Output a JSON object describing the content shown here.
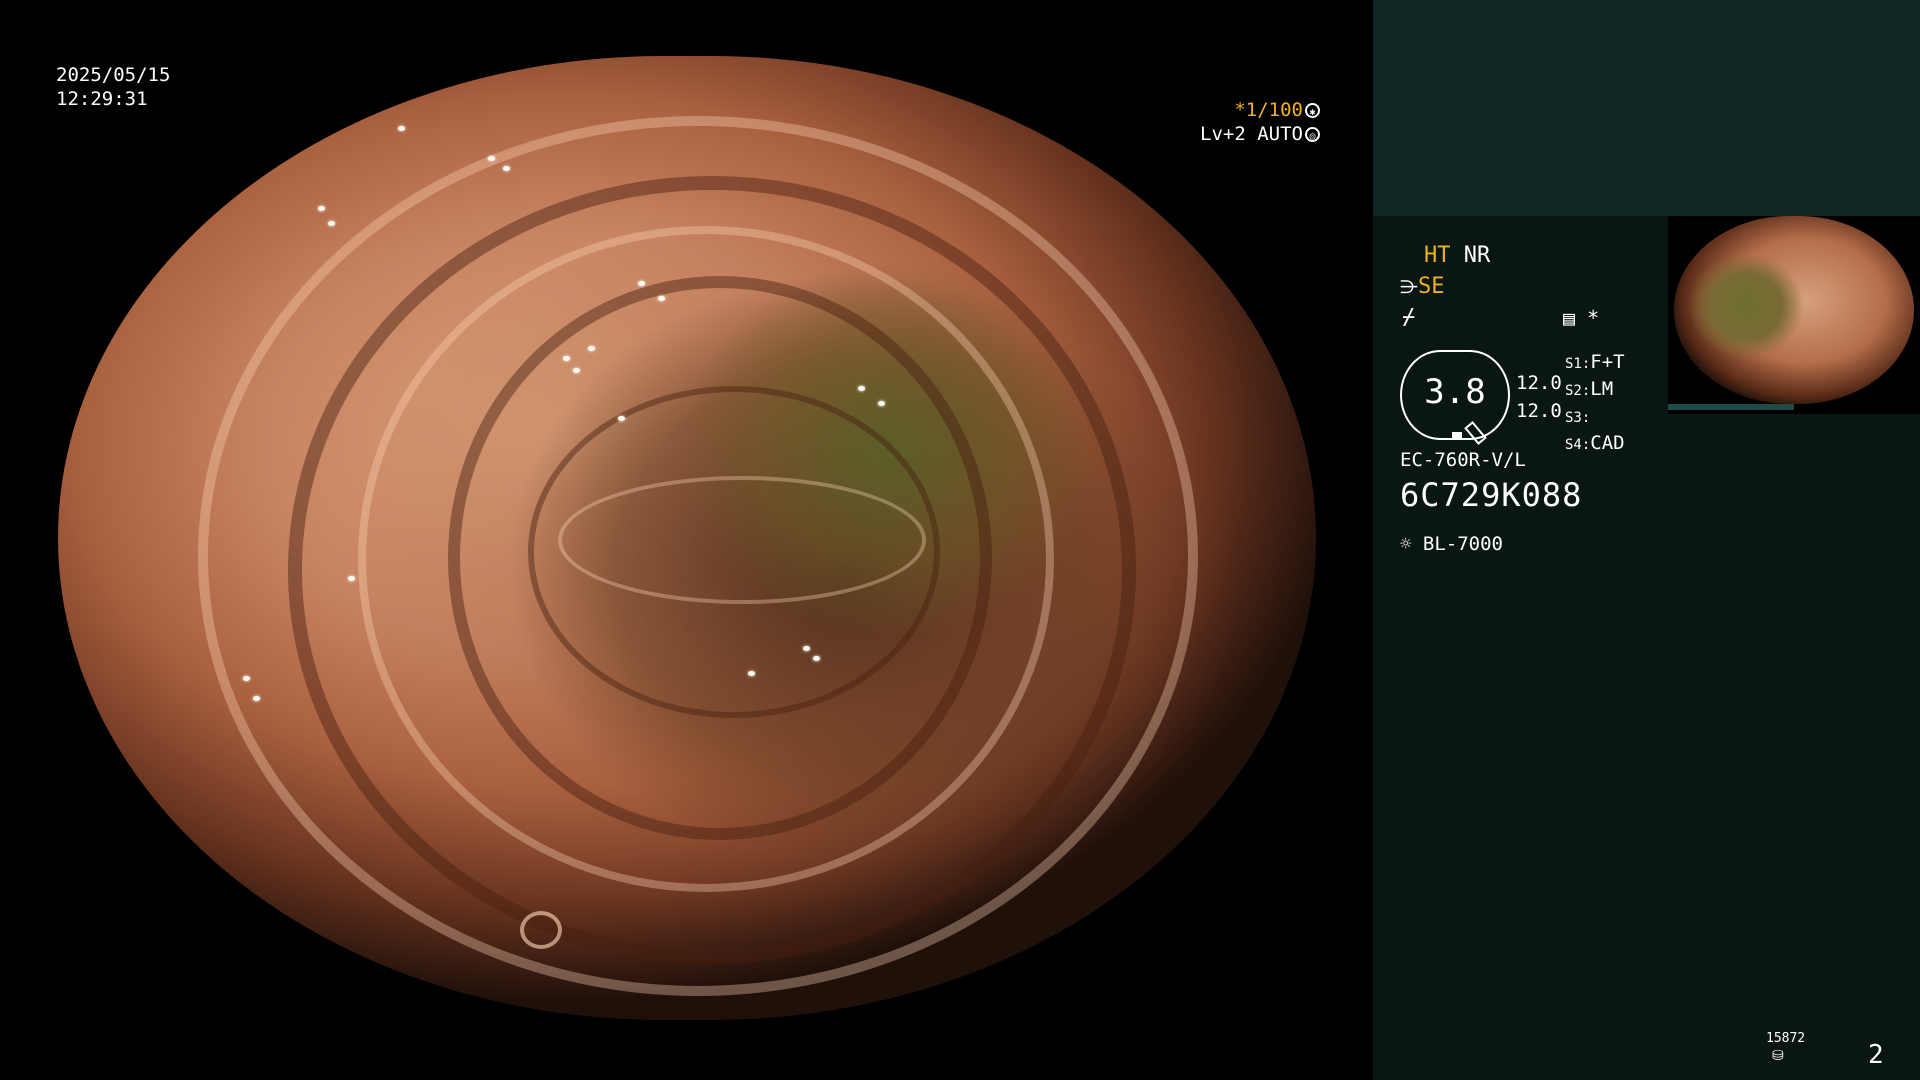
{
  "timestamp": {
    "date": "2025/05/15",
    "time": "12:29:31"
  },
  "shutter": {
    "value": "*1/100",
    "level": "Lv+2",
    "mode": "AUTO",
    "value_color": "#f0b020"
  },
  "panel": {
    "ht": "HT",
    "nr": "NR",
    "se": "SE",
    "zoom_value": "3.8",
    "zoom_a": "12.0",
    "zoom_b": "12.0",
    "switches": [
      {
        "key": "S1:",
        "value": "F+T"
      },
      {
        "key": "S2:",
        "value": "LM"
      },
      {
        "key": "S3:",
        "value": ""
      },
      {
        "key": "S4:",
        "value": "CAD"
      }
    ],
    "scope_model": "EC-760R-V/L",
    "serial": "6C729K088",
    "light_source": "BL-7000",
    "image_count": "15872",
    "page_number": "2",
    "accent_yellow": "#f0b020"
  }
}
